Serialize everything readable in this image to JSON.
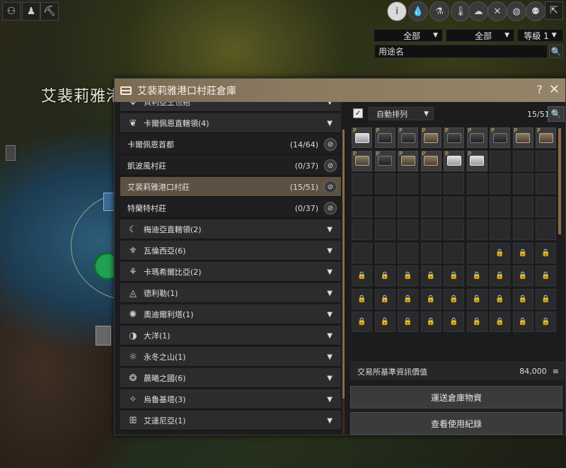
{
  "map": {
    "region_label": "艾裴莉雅港"
  },
  "toolbar_left": {
    "icons": [
      "people-icon",
      "person-marker-icon",
      "pickaxe-icon"
    ]
  },
  "toolbar_right": {
    "icons": [
      "info-icon",
      "drop-icon",
      "flask-icon",
      "thermometer-icon",
      "cloud-icon",
      "crossed-swords-icon",
      "globe-icon",
      "group-icon",
      "exit-icon"
    ]
  },
  "filters": {
    "filter1": "全部",
    "filter2": "全部",
    "level": "等級 1"
  },
  "search": {
    "placeholder": "用途名"
  },
  "window": {
    "title": "艾裴莉雅港口村莊倉庫",
    "help": "?",
    "close": "✕"
  },
  "left_list": {
    "top_partial": "貝利亞王也抱",
    "groups_top": {
      "label": "卡爾佩恩直轄領(4)"
    },
    "subs": [
      {
        "label": "卡爾佩恩首都",
        "count": "(14/64)"
      },
      {
        "label": "凱波風村莊",
        "count": "(0/37)"
      },
      {
        "label": "艾裴莉雅港口村莊",
        "count": "(15/51)"
      },
      {
        "label": "特蘭特村莊",
        "count": "(0/37)"
      }
    ],
    "groups": [
      {
        "label": "梅迪亞直轄領(2)"
      },
      {
        "label": "瓦倫西亞(6)"
      },
      {
        "label": "卡瑪希爾比亞(2)"
      },
      {
        "label": "德利勒(1)"
      },
      {
        "label": "奧迪爾利塔(1)"
      },
      {
        "label": "大洋(1)"
      },
      {
        "label": "永冬之山(1)"
      },
      {
        "label": "晨曦之國(6)"
      },
      {
        "label": "烏魯基塔(3)"
      },
      {
        "label": "艾達尼亞(1)"
      }
    ]
  },
  "right_panel": {
    "autosort_checked": "✓",
    "autosort_label": "自動排列",
    "slots": "15/51",
    "items_filled": 15,
    "slots_open": 51,
    "slots_total": 81,
    "p_badge": "P"
  },
  "market": {
    "label": "交易所基準資訊價值",
    "value": "84,000"
  },
  "buttons": {
    "transport": "運送倉庫物資",
    "history": "查看使用紀錄"
  }
}
